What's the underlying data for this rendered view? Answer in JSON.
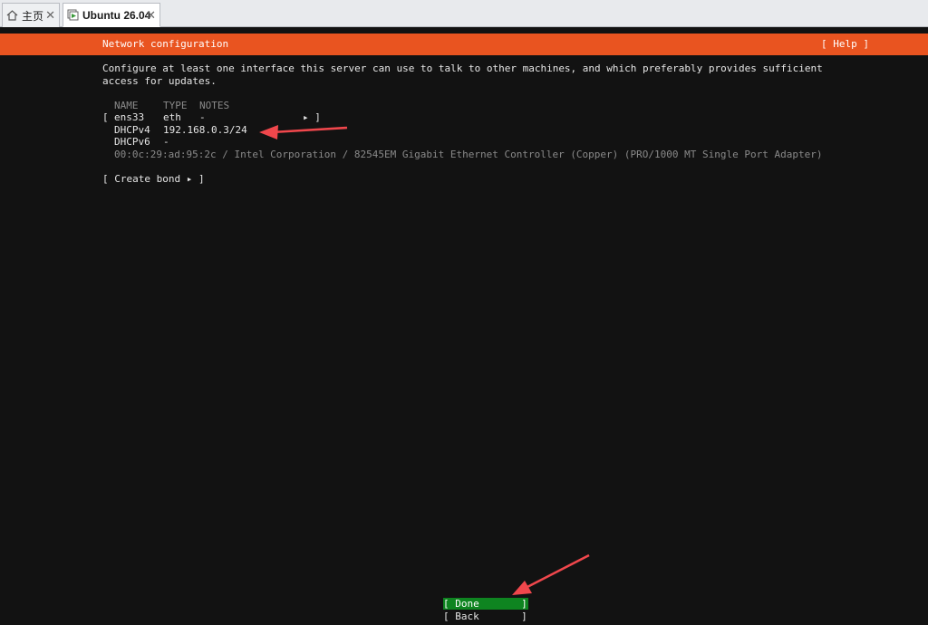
{
  "tabs": [
    {
      "label": "主页",
      "icon": "home-icon"
    },
    {
      "label": "Ubuntu 26.04",
      "icon": "vm-icon"
    }
  ],
  "header": {
    "title": "Network configuration",
    "help": "[ Help ]"
  },
  "intro": {
    "line1": "Configure at least one interface this server can use to talk to other machines, and which preferably provides sufficient",
    "line2": "access for updates."
  },
  "table": {
    "columns": [
      "NAME",
      "TYPE",
      "NOTES"
    ],
    "interface": {
      "open_bracket": "[",
      "name": "ens33",
      "type": "eth",
      "notes": "-",
      "menu_marker": "▸ ]"
    },
    "rows": [
      {
        "label": "DHCPv4",
        "value": "192.168.0.3/24"
      },
      {
        "label": "DHCPv6",
        "value": "-"
      }
    ],
    "details": "00:0c:29:ad:95:2c / Intel Corporation / 82545EM Gigabit Ethernet Controller (Copper) (PRO/1000 MT Single Port Adapter)"
  },
  "create_bond": "[ Create bond ▸ ]",
  "buttons": {
    "done": "[ Done       ]",
    "back": "[ Back       ]"
  },
  "colors": {
    "header": "#e95420",
    "done_highlight": "#0e8420",
    "background": "#121212",
    "annotation_arrow": "#f0474c"
  }
}
